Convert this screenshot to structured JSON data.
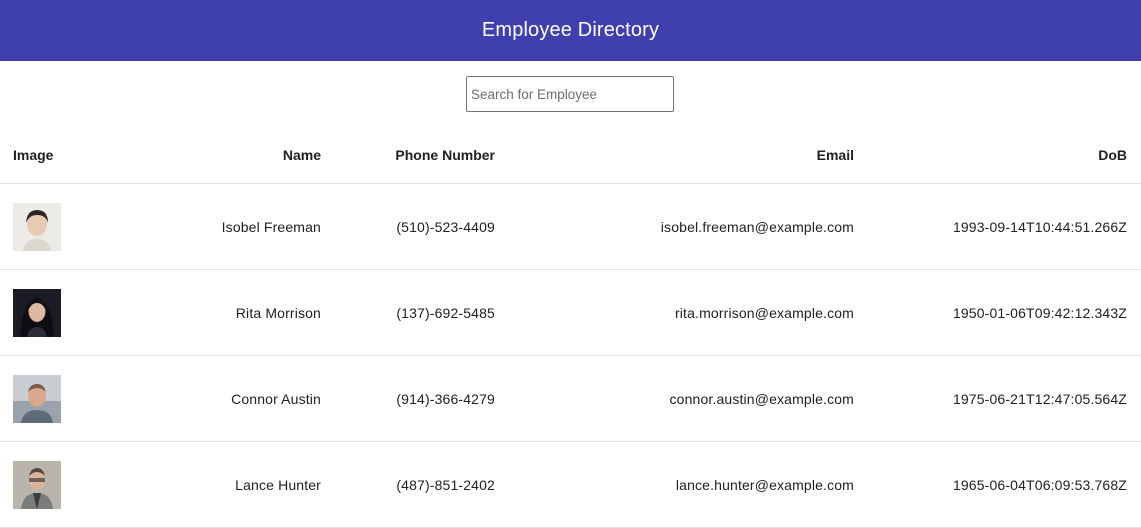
{
  "header": {
    "title": "Employee Directory",
    "color": "#3f3fb0"
  },
  "search": {
    "placeholder": "Search for Employee",
    "value": ""
  },
  "table": {
    "columns": [
      "Image",
      "Name",
      "Phone Number",
      "Email",
      "DoB"
    ],
    "rows": [
      {
        "image": "employee-photo",
        "name": "Isobel Freeman",
        "phone": "(510)-523-4409",
        "email": "isobel.freeman@example.com",
        "dob": "1993-09-14T10:44:51.266Z"
      },
      {
        "image": "employee-photo",
        "name": "Rita Morrison",
        "phone": "(137)-692-5485",
        "email": "rita.morrison@example.com",
        "dob": "1950-01-06T09:42:12.343Z"
      },
      {
        "image": "employee-photo",
        "name": "Connor Austin",
        "phone": "(914)-366-4279",
        "email": "connor.austin@example.com",
        "dob": "1975-06-21T12:47:05.564Z"
      },
      {
        "image": "employee-photo",
        "name": "Lance Hunter",
        "phone": "(487)-851-2402",
        "email": "lance.hunter@example.com",
        "dob": "1965-06-04T06:09:53.768Z"
      }
    ]
  }
}
